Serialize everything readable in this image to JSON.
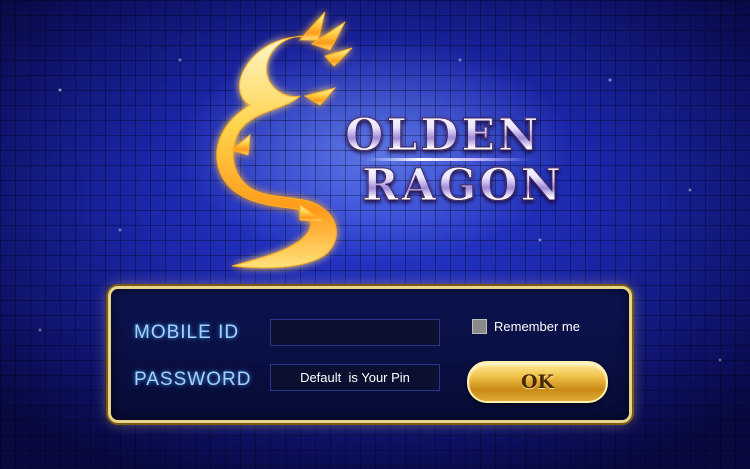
{
  "logo": {
    "line1": "OLDEN",
    "line2": "RAGON"
  },
  "form": {
    "mobile_id_label": "MOBILE  ID",
    "mobile_id_value": "",
    "password_label": "PASSWORD",
    "password_placeholder": "Default  is Your Pin",
    "remember_label": "Remember me",
    "remember_checked": false,
    "ok_label": "OK"
  },
  "colors": {
    "background": "#1b26a8",
    "panel_border": "#e8d48b",
    "label": "#9fd4ff",
    "button": "#f0c24a"
  },
  "icons": {
    "logo": "golden-dragon-emblem"
  }
}
